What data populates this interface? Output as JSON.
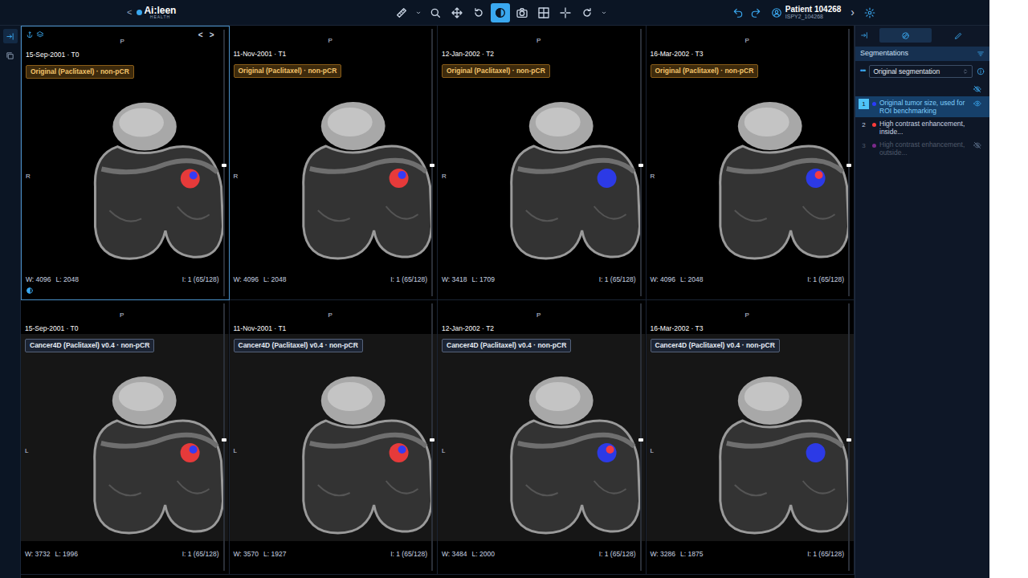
{
  "app": {
    "back": "<",
    "logo": "Ai:leen",
    "logo_sub": "HEALTH"
  },
  "toolbar": {
    "tools": [
      {
        "selected": false
      },
      {
        "selected": false
      },
      {
        "selected": false
      },
      {
        "selected": false
      },
      {
        "selected": false
      },
      {
        "selected": true
      },
      {
        "selected": false
      },
      {
        "selected": false
      },
      {
        "selected": false
      },
      {
        "selected": false
      },
      {
        "selected": false
      }
    ]
  },
  "patient": {
    "title": "Patient 104268",
    "id": "ISPY2_104268",
    "next": "›"
  },
  "left_rail": [
    {
      "selected": true
    },
    {
      "selected": false
    }
  ],
  "viewer": {
    "nav": [
      "<",
      ">"
    ]
  },
  "viewports": [
    {
      "date": "15-Sep-2001 · T0",
      "top": "P",
      "badge": "Original (Paclitaxel) · non-pCR",
      "kind": "original",
      "side": "R",
      "window": "W: 4096",
      "level": "L: 2048",
      "index": "I: 1 (65/128)",
      "slice_level": 0.51,
      "selected": true,
      "segments": [
        {
          "color": "#ff3b3b"
        },
        {
          "color": "#2b3bff"
        }
      ]
    },
    {
      "date": "11-Nov-2001 · T1",
      "top": "P",
      "badge": "Original (Paclitaxel) · non-pCR",
      "kind": "original",
      "side": "R",
      "window": "W: 4096",
      "level": "L: 2048",
      "index": "I: 1 (65/128)",
      "slice_level": 0.51,
      "selected": false,
      "segments": [
        {
          "color": "#ff3b3b"
        },
        {
          "color": "#2b3bff"
        }
      ]
    },
    {
      "date": "12-Jan-2002 · T2",
      "top": "P",
      "badge": "Original (Paclitaxel) · non-pCR",
      "kind": "original",
      "side": "R",
      "window": "W: 3418",
      "level": "L: 1709",
      "index": "I: 1 (65/128)",
      "slice_level": 0.51,
      "selected": false,
      "segments": [
        {
          "color": "#2b3bff"
        }
      ]
    },
    {
      "date": "16-Mar-2002 · T3",
      "top": "P",
      "badge": "Original (Paclitaxel) · non-pCR",
      "kind": "original",
      "side": "R",
      "window": "W: 4096",
      "level": "L: 2048",
      "index": "I: 1 (65/128)",
      "slice_level": 0.51,
      "selected": false,
      "segments": [
        {
          "color": "#2b3bff"
        },
        {
          "color": "#ff3b3b"
        }
      ]
    },
    {
      "date": "15-Sep-2001 · T0",
      "top": "P",
      "badge": "Cancer4D (Paclitaxel) v0.4 · non-pCR",
      "kind": "model",
      "side": "L",
      "window": "W: 3732",
      "level": "L: 1996",
      "index": "I: 1 (65/128)",
      "slice_level": 0.51,
      "selected": false,
      "segments": [
        {
          "color": "#ff3b3b"
        },
        {
          "color": "#2b3bff"
        }
      ]
    },
    {
      "date": "11-Nov-2001 · T1",
      "top": "P",
      "badge": "Cancer4D (Paclitaxel) v0.4 · non-pCR",
      "kind": "model",
      "side": "L",
      "window": "W: 3570",
      "level": "L: 1927",
      "index": "I: 1 (65/128)",
      "slice_level": 0.51,
      "selected": false,
      "segments": [
        {
          "color": "#ff3b3b"
        },
        {
          "color": "#2b3bff"
        }
      ]
    },
    {
      "date": "12-Jan-2002 · T2",
      "top": "P",
      "badge": "Cancer4D (Paclitaxel) v0.4 · non-pCR",
      "kind": "model",
      "side": "L",
      "window": "W: 3484",
      "level": "L: 2000",
      "index": "I: 1 (65/128)",
      "slice_level": 0.51,
      "selected": false,
      "segments": [
        {
          "color": "#2b3bff"
        },
        {
          "color": "#ff3b3b"
        }
      ]
    },
    {
      "date": "16-Mar-2002 · T3",
      "top": "P",
      "badge": "Cancer4D (Paclitaxel) v0.4 · non-pCR",
      "kind": "model",
      "side": "L",
      "window": "W: 3286",
      "level": "L: 1875",
      "index": "I: 1 (65/128)",
      "slice_level": 0.51,
      "selected": false,
      "segments": [
        {
          "color": "#2b3bff"
        }
      ]
    }
  ],
  "side_panel": {
    "tabs": [
      {
        "selected": true
      },
      {
        "selected": false
      }
    ],
    "header": "Segmentations",
    "menu": "•••",
    "dropdown": "Original segmentation",
    "segments": [
      {
        "number": "1",
        "label": "Original tumor size, used for ROI benchmarking",
        "color": "#2b3bff",
        "visible": true,
        "selected": true
      },
      {
        "number": "2",
        "label": "High contrast enhancement, inside...",
        "color": "#ff3b3b",
        "visible": true,
        "selected": false
      },
      {
        "number": "3",
        "label": "High contrast enhancement, outside...",
        "color": "#7a2a8a",
        "visible": false,
        "selected": false
      }
    ]
  }
}
